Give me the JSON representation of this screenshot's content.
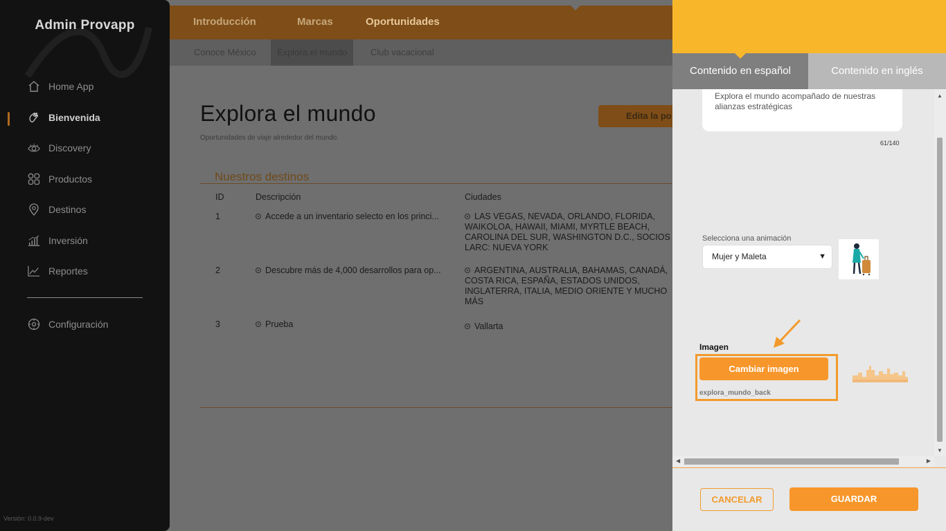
{
  "sidebar": {
    "brand": "Admin Provapp",
    "items": [
      {
        "label": "Home App",
        "icon": "home-icon"
      },
      {
        "label": "Bienvenida",
        "icon": "hand-wave-icon"
      },
      {
        "label": "Discovery",
        "icon": "eye-icon"
      },
      {
        "label": "Productos",
        "icon": "grid-icon"
      },
      {
        "label": "Destinos",
        "icon": "location-pin-icon"
      },
      {
        "label": "Inversión",
        "icon": "bar-chart-icon"
      },
      {
        "label": "Reportes",
        "icon": "line-chart-icon"
      }
    ],
    "settings": {
      "label": "Configuración",
      "icon": "gear-icon"
    },
    "version": "Versión: 0.0.9-dev",
    "active_item": "Bienvenida"
  },
  "topnav": {
    "tabs": [
      "Introducción",
      "Marcas",
      "Oportunidades"
    ],
    "active": "Oportunidades"
  },
  "subnav": {
    "tabs": [
      "Conoce México",
      "Explora el mundo",
      "Club vacacional"
    ],
    "active": "Explora el mundo"
  },
  "main": {
    "title": "Explora el mundo",
    "subtitle": "Oportunidades de viaje alrededor del mundo.",
    "edit_button": "Edita la po",
    "section_title": "Nuestros destinos",
    "table": {
      "headers": [
        "ID",
        "Descripción",
        "Ciudades"
      ],
      "rows": [
        {
          "id": "1",
          "descripcion": "Accede a un inventario selecto en los princi...",
          "ciudades": "LAS VEGAS, NEVADA, ORLANDO, FLORIDA, WAIKOLOA, HAWAII, MIAMI, MYRTLE BEACH, CAROLINA DEL SUR, WASHINGTON D.C., SOCIOS LARC: NUEVA YORK"
        },
        {
          "id": "2",
          "descripcion": "Descubre más de 4,000 desarrollos para op...",
          "ciudades": "ARGENTINA, AUSTRALIA, BAHAMAS, CANADÁ, COSTA RICA, ESPAÑA, ESTADOS UNIDOS, INGLATERRA, ITALIA, MEDIO ORIENTE Y MUCHO MÁS"
        },
        {
          "id": "3",
          "descripcion": "Prueba",
          "ciudades": "Vallarta"
        }
      ]
    }
  },
  "panel": {
    "tabs": [
      "Contenido en español",
      "Contenido en inglés"
    ],
    "active_tab": "Contenido en español",
    "description_value": "Explora el mundo acompañado de nuestras alianzas estratégicas",
    "char_count": "61/140",
    "animation_label": "Selecciona una animación",
    "animation_value": "Mujer y Maleta",
    "image_label": "Imagen",
    "change_image_button": "Cambiar imagen",
    "image_filename": "explora_mundo_back",
    "cancel_button": "CANCELAR",
    "save_button": "GUARDAR"
  },
  "colors": {
    "accent": "#f7962a",
    "panel_header": "#f8b72b",
    "sidebar_bg": "#121212",
    "overlay": "#6f6f6f"
  }
}
